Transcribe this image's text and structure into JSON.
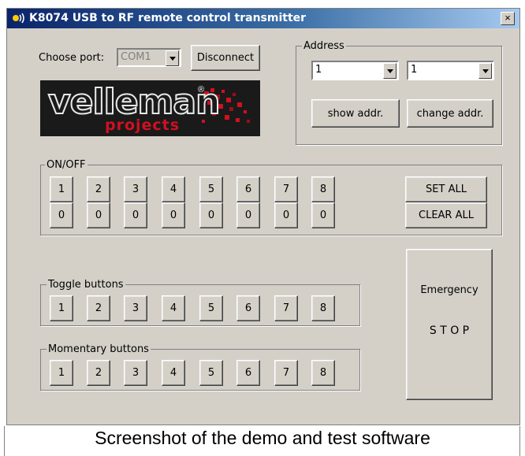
{
  "window": {
    "title": "K8074  USB to RF remote control transmitter",
    "close_label": "×"
  },
  "port": {
    "label": "Choose port:",
    "value": "COM1",
    "disconnect_label": "Disconnect"
  },
  "logo": {
    "name": "velleman",
    "registered": "®",
    "sub": "projects"
  },
  "address": {
    "group_label": "Address",
    "combo1_value": "1",
    "combo2_value": "1",
    "show_label": "show addr.",
    "change_label": "change addr."
  },
  "onoff": {
    "group_label": "ON/OFF",
    "on_buttons": [
      "1",
      "2",
      "3",
      "4",
      "5",
      "6",
      "7",
      "8"
    ],
    "off_buttons": [
      "0",
      "0",
      "0",
      "0",
      "0",
      "0",
      "0",
      "0"
    ],
    "set_all_label": "SET ALL",
    "clear_all_label": "CLEAR ALL"
  },
  "toggle": {
    "group_label": "Toggle buttons",
    "buttons": [
      "1",
      "2",
      "3",
      "4",
      "5",
      "6",
      "7",
      "8"
    ]
  },
  "momentary": {
    "group_label": "Momentary buttons",
    "buttons": [
      "1",
      "2",
      "3",
      "4",
      "5",
      "6",
      "7",
      "8"
    ]
  },
  "emergency": {
    "line1": "Emergency",
    "line2": "S T O P"
  },
  "caption": "Screenshot of the demo and test software",
  "colors": {
    "title_start": "#0a246a",
    "title_end": "#a6caf0",
    "window_bg": "#d4d0c8",
    "logo_bg": "#1a1a1a",
    "logo_accent": "#d01020"
  }
}
